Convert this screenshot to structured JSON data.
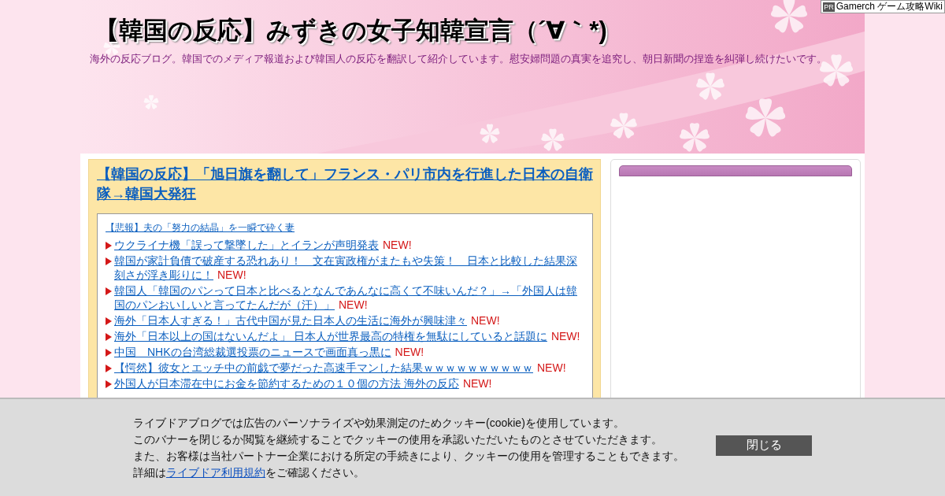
{
  "ad_badge": {
    "mark": "PR",
    "label": "Gamerch ゲーム攻略Wiki"
  },
  "header": {
    "title": "【韓国の反応】みずきの女子知韓宣言（´∀｀*)",
    "description": "海外の反応ブログ。韓国でのメディア報道および韓国人の反応を翻訳して紹介しています。慰安婦問題の真実を追究し、朝日新聞の捏造を糾弾し続けたいです。"
  },
  "article": {
    "title": "【韓国の反応】「旭日旗を翻して」フランス・パリ市内を行進した日本の自衛隊→韓国大発狂",
    "related": {
      "small_link": "【悲報】夫の「努力の結晶」を一瞬で砕く妻",
      "items": [
        {
          "text": "ウクライナ機「誤って撃墜した」とイランが声明発表",
          "badge": "NEW!"
        },
        {
          "text": "韓国が家計負債で破産する恐れあり！　文在寅政権がまたもや失策！　日本と比較した結果深刻さが浮き彫りに！",
          "badge": "NEW!"
        },
        {
          "text": "韓国人「韓国のパンって日本と比べるとなんであんなに高くて不味いんだ？」→「外国人は韓国のパンおいしいと言ってたんだが（汗）」",
          "badge": "NEW!"
        },
        {
          "text": "海外「日本人すぎる！」古代中国が見た日本人の生活に海外が興味津々",
          "badge": "NEW!"
        },
        {
          "text": "海外「日本以上の国はないんだよ」 日本人が世界最高の特権を無駄にしていると話題に",
          "badge": "NEW!"
        },
        {
          "text": "中国　NHKの台湾総裁選投票のニュースで画面真っ黒に",
          "badge": "NEW!"
        },
        {
          "text": "【愕然】彼女とエッチ中の前戯で夢だった高速手マンした結果ｗｗｗｗｗｗｗｗｗｗ",
          "badge": "NEW!"
        },
        {
          "text": "外国人が日本滞在中にお金を節約するための１０個の方法 海外の反応",
          "badge": "NEW!"
        }
      ]
    }
  },
  "cookie_banner": {
    "lines": [
      "ライブドアブログでは広告のパーソナライズや効果測定のためクッキー(cookie)を使用しています。",
      "このバナーを閉じるか閲覧を継続することでクッキーの使用を承認いただいたものとさせていただきます。",
      "また、お客様は当社パートナー企業における所定の手続きにより、クッキーの使用を管理することもできます。"
    ],
    "detail_prefix": "詳細は",
    "detail_link": "ライブドア利用規約",
    "detail_suffix": "をご確認ください。",
    "close_button": "閉じる"
  }
}
